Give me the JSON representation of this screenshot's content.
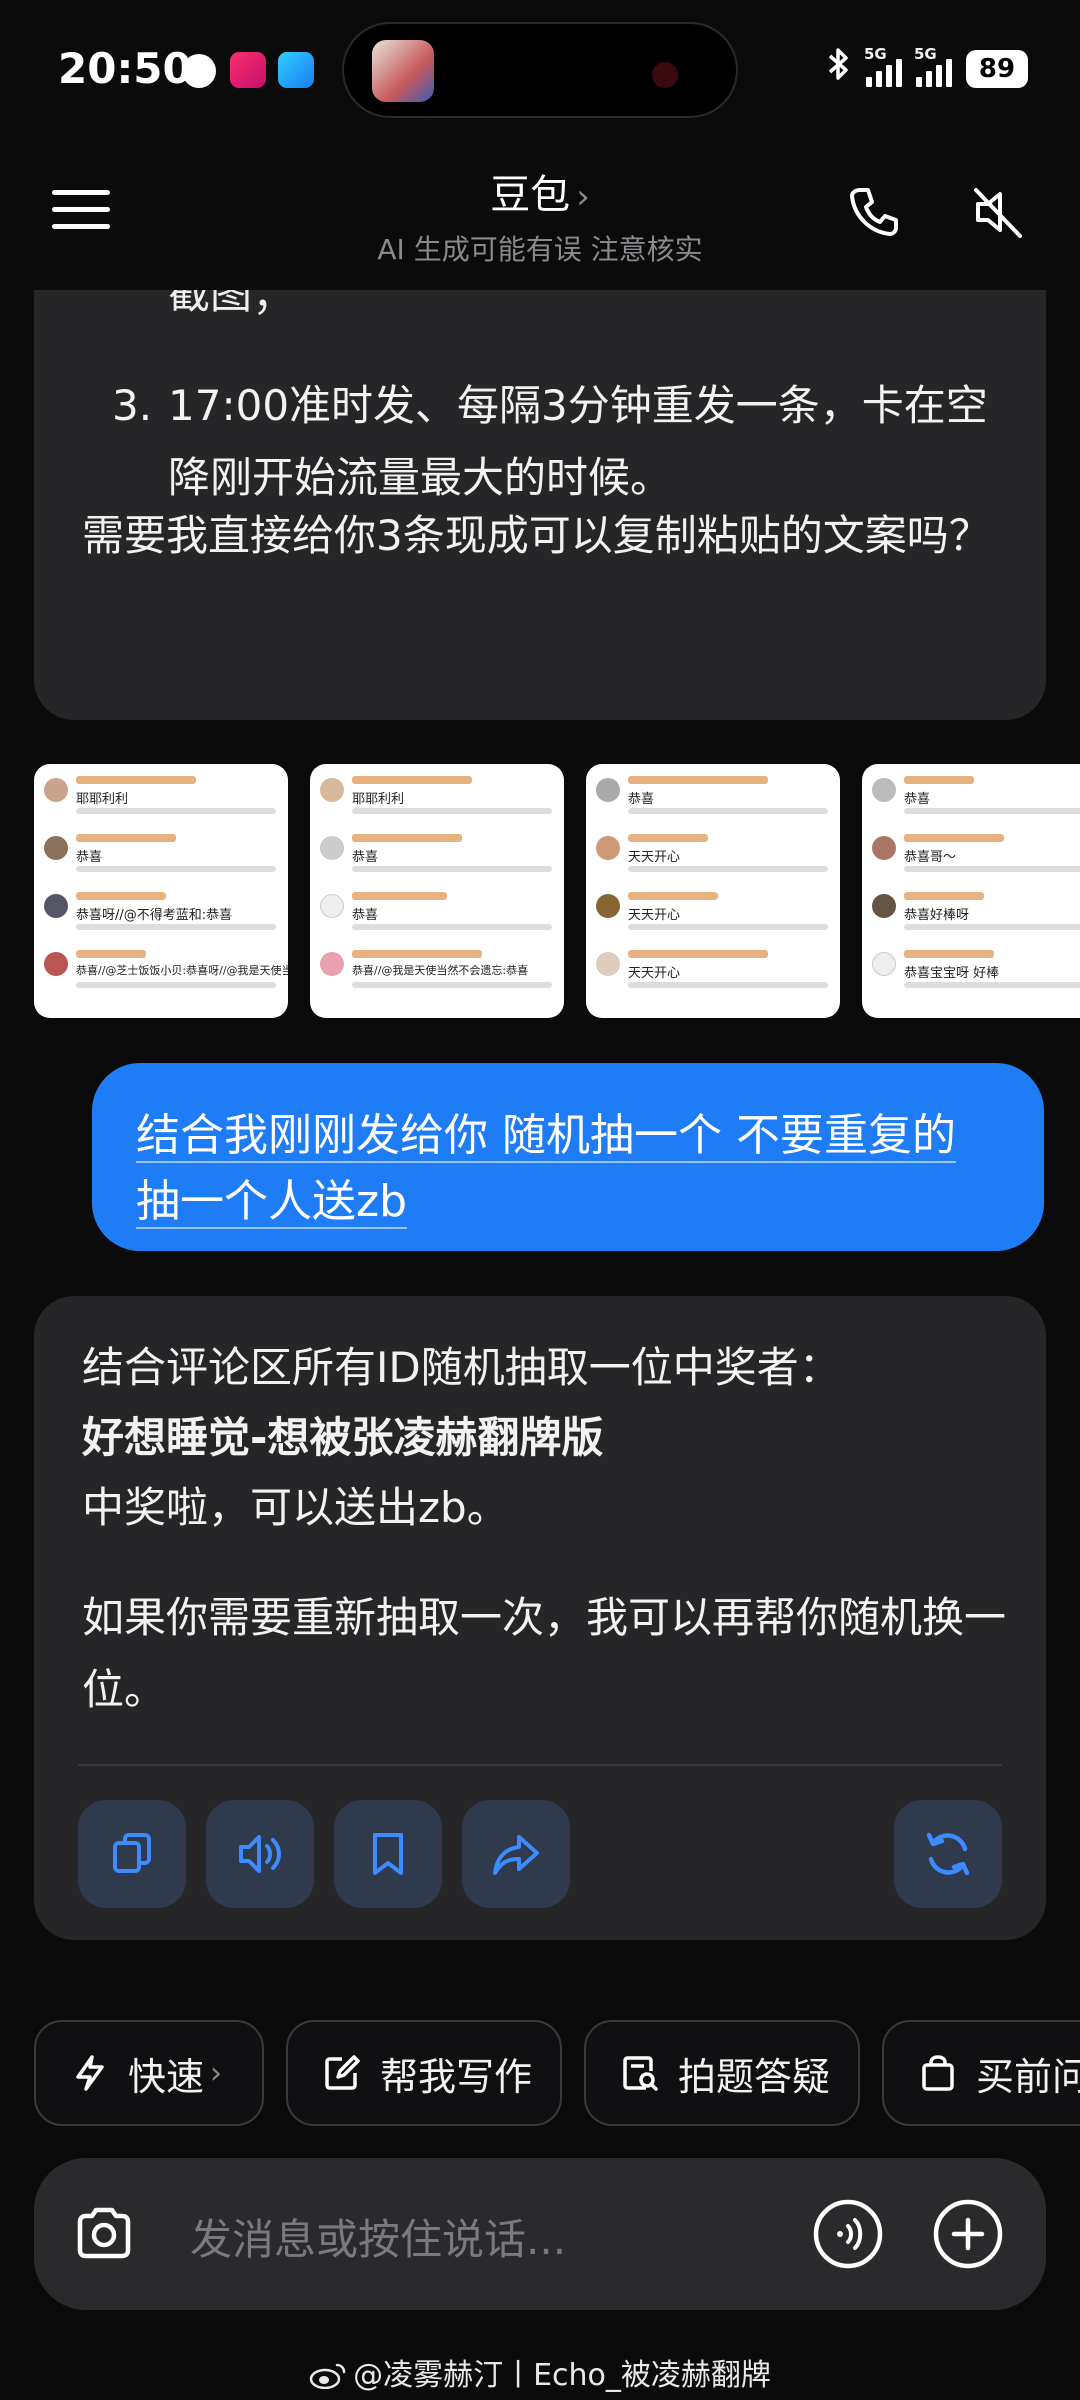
{
  "status_bar": {
    "time": "20:50",
    "net1": "5G",
    "net2": "5G",
    "battery": "89"
  },
  "header": {
    "title": "豆包",
    "title_chevron": "›",
    "subtitle": "AI 生成可能有误 注意核实",
    "icons": [
      "menu-icon",
      "phone-icon",
      "mute-icon"
    ]
  },
  "messages": {
    "ai_prev": {
      "cut_text": "截图；",
      "list_num": "3.",
      "list_item": "17:00准时发、每隔3分钟重发一条，卡在空降刚开始流量最大的时候。",
      "question": "需要我直接给你3条现成可以复制粘贴的文案吗？"
    },
    "thumbnails": [
      {
        "rows": [
          "耶耶利利",
          "恭喜",
          "恭喜呀//@不得考蓝和:恭喜",
          "恭喜//@芝士饭饭小贝:恭喜呀//@我是天使当然不会遗忘:恭喜"
        ]
      },
      {
        "rows": [
          "耶耶利利",
          "恭喜",
          "恭喜",
          "恭喜//@我是天使当然不会遗忘:恭喜"
        ]
      },
      {
        "rows": [
          "恭喜",
          "天天开心",
          "天天开心",
          "天天开心"
        ]
      },
      {
        "rows": [
          "恭喜",
          "恭喜哥～",
          "恭喜好棒呀",
          "恭喜宝宝呀 好棒"
        ]
      }
    ],
    "user": {
      "text": "结合我刚刚发给你 随机抽一个 不要重复的 抽一个人送zb"
    },
    "ai_reply": {
      "line1": "结合评论区所有ID随机抽取一位中奖者：",
      "winner": "好想睡觉-想被张凌赫翻牌版",
      "line3": "中奖啦，可以送出zb。",
      "line4": "如果你需要重新抽取一次，我可以再帮你随机换一位。",
      "actions": [
        "copy-icon",
        "speaker-icon",
        "bookmark-icon",
        "share-icon",
        "regenerate-icon"
      ]
    }
  },
  "chips": [
    {
      "label": "快速",
      "icon": "bolt-icon",
      "chevron": "›"
    },
    {
      "label": "帮我写作",
      "icon": "edit-icon"
    },
    {
      "label": "拍题答疑",
      "icon": "scan-icon"
    },
    {
      "label": "买前问",
      "icon": "bag-icon"
    }
  ],
  "input": {
    "placeholder": "发消息或按住说话..."
  },
  "watermark": "@凌雾赫汀丨Echo_被凌赫翻牌"
}
